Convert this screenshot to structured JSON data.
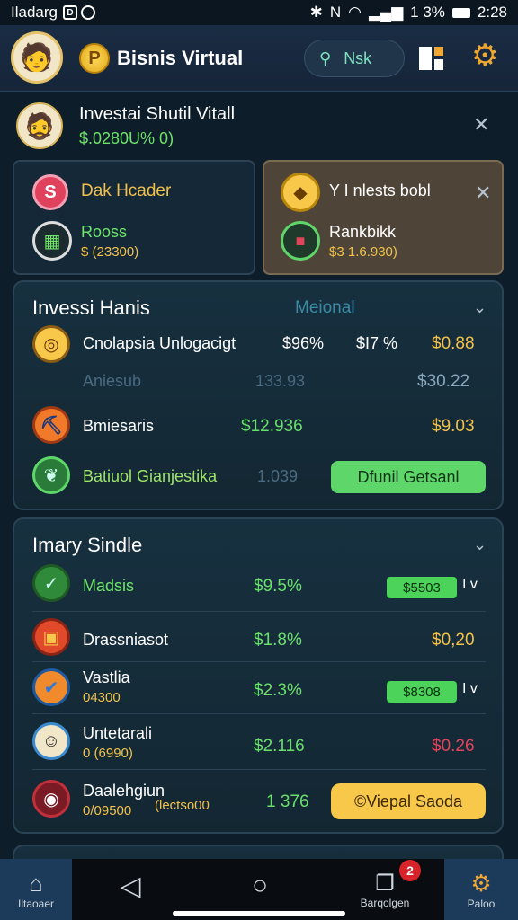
{
  "status_bar": {
    "carrier": "Iladarg",
    "battery": "1 3%",
    "time": "2:28"
  },
  "app_bar": {
    "coin_symbol": "P",
    "title": "Bisnis Virtual",
    "search_label": "Nsk"
  },
  "profile": {
    "name": "Investai Shutil Vitall",
    "value": "$.0280U% 0)"
  },
  "card_left": {
    "row1_label": "Dak Hcader",
    "row2_title": "Rooss",
    "row2_value": "$ (23300)"
  },
  "card_right": {
    "title": "Y I nlests bobl",
    "sub_title": "Rankbikk",
    "sub_value": "$3 1.6.930)"
  },
  "panel1": {
    "title": "Invessi Hanis",
    "tab_label": "Meional",
    "rows": [
      {
        "name": "Cnolapsia Unlogacigt",
        "col1": "$96%",
        "col2": "$I7 %",
        "col3": "$0.88"
      },
      {
        "name": "Aniesub",
        "col1": "",
        "col2": "133.93",
        "col3": "$30.22"
      },
      {
        "name": "Bmiesaris",
        "col1": "",
        "col2": "$12.936",
        "col3": "$9.03"
      },
      {
        "name": "Batiuol Gianjestika",
        "col2": "1.039",
        "button": "Dfunil Getsanl"
      }
    ]
  },
  "panel2": {
    "title": "Imary Sindle",
    "rows": [
      {
        "name": "Madsis",
        "value": "$9.5%",
        "pill": "$5503",
        "suffix": "I v"
      },
      {
        "name": "Drassniasot",
        "value": "$1.8%",
        "right": "$0,20"
      },
      {
        "name": "Vastlia",
        "sub": "04300",
        "value": "$2.3%",
        "pill": "$8308",
        "suffix": "I v"
      },
      {
        "name": "Untetarali",
        "sub": "0 (6990)",
        "value": "$2.116",
        "right": "$0.26"
      },
      {
        "name": "Daalehgiun",
        "sub": "0/09500",
        "sub2": "(lectso00",
        "value": "1 376",
        "button": "©Viepal Saoda"
      }
    ]
  },
  "nav": {
    "home_label": "Iltaoaer",
    "bag_label": "Barqolgen",
    "bag_badge": "2",
    "settings_label": "Paloo"
  },
  "colors": {
    "accent_green": "#5ed66a",
    "accent_gold": "#f2c14a",
    "accent_red": "#e0445a"
  }
}
